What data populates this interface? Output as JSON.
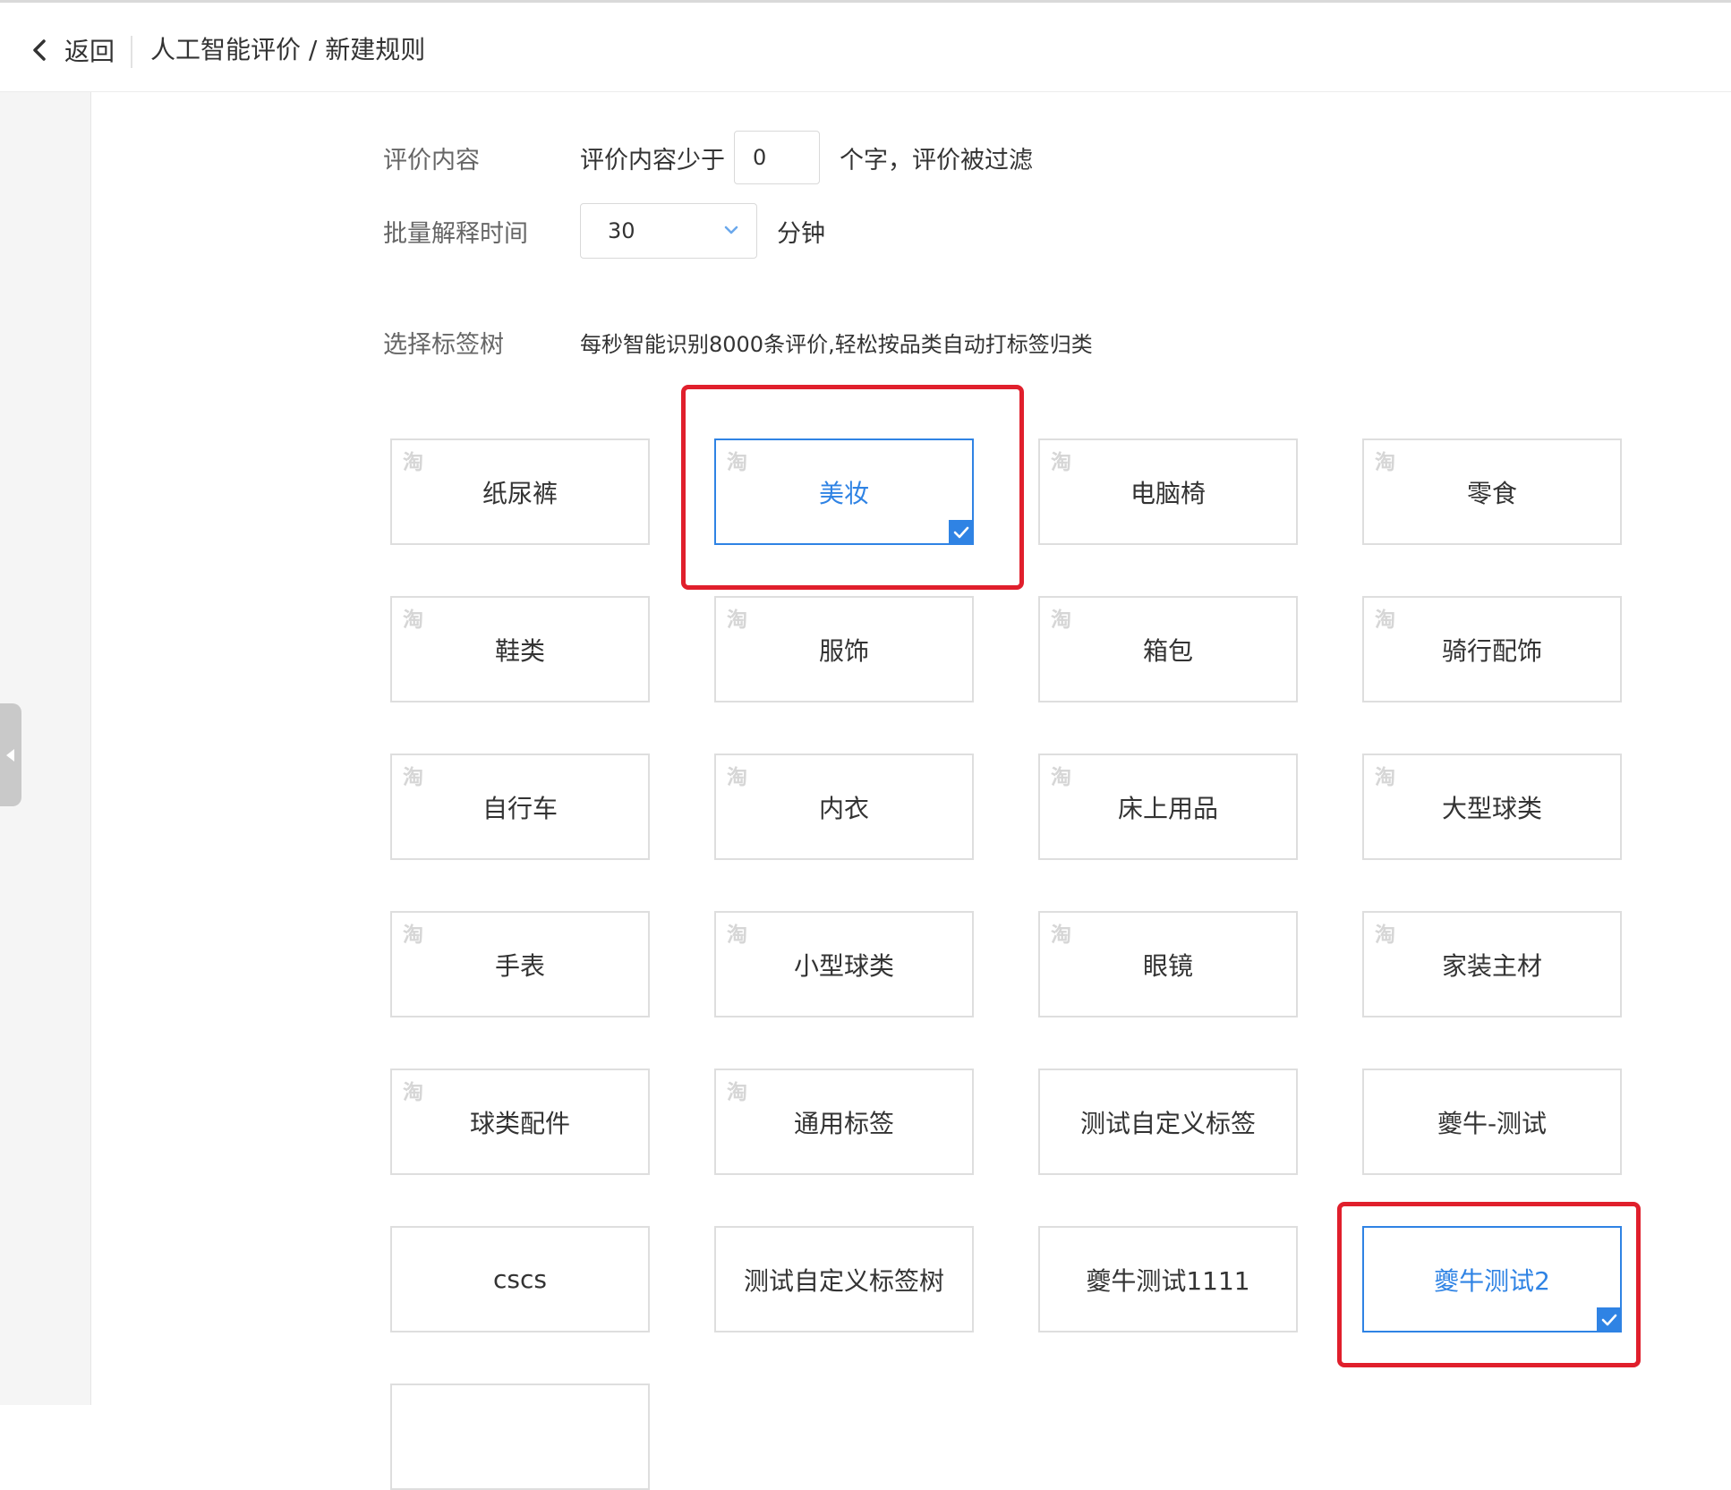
{
  "header": {
    "back_label": "返回",
    "breadcrumb": "人工智能评价 / 新建规则"
  },
  "form": {
    "content_label": "评价内容",
    "content_prefix": "评价内容少于",
    "content_value": "0",
    "content_suffix": "个字，评价被过滤",
    "batch_label": "批量解释时间",
    "batch_value": "30",
    "batch_unit": "分钟",
    "tree_label": "选择标签树",
    "tree_hint": "每秒智能识别8000条评价,轻松按品类自动打标签归类"
  },
  "tao_glyph": "淘",
  "tiles": [
    {
      "name": "纸尿裤",
      "tao": true,
      "selected": false
    },
    {
      "name": "美妆",
      "tao": true,
      "selected": true
    },
    {
      "name": "电脑椅",
      "tao": true,
      "selected": false
    },
    {
      "name": "零食",
      "tao": true,
      "selected": false
    },
    {
      "name": "鞋类",
      "tao": true,
      "selected": false
    },
    {
      "name": "服饰",
      "tao": true,
      "selected": false
    },
    {
      "name": "箱包",
      "tao": true,
      "selected": false
    },
    {
      "name": "骑行配饰",
      "tao": true,
      "selected": false
    },
    {
      "name": "自行车",
      "tao": true,
      "selected": false
    },
    {
      "name": "内衣",
      "tao": true,
      "selected": false
    },
    {
      "name": "床上用品",
      "tao": true,
      "selected": false
    },
    {
      "name": "大型球类",
      "tao": true,
      "selected": false
    },
    {
      "name": "手表",
      "tao": true,
      "selected": false
    },
    {
      "name": "小型球类",
      "tao": true,
      "selected": false
    },
    {
      "name": "眼镜",
      "tao": true,
      "selected": false
    },
    {
      "name": "家装主材",
      "tao": true,
      "selected": false
    },
    {
      "name": "球类配件",
      "tao": true,
      "selected": false
    },
    {
      "name": "通用标签",
      "tao": true,
      "selected": false
    },
    {
      "name": "测试自定义标签",
      "tao": false,
      "selected": false
    },
    {
      "name": "夔牛-测试",
      "tao": false,
      "selected": false
    },
    {
      "name": "cscs",
      "tao": false,
      "selected": false
    },
    {
      "name": "测试自定义标签树",
      "tao": false,
      "selected": false
    },
    {
      "name": "夔牛测试1111",
      "tao": false,
      "selected": false
    },
    {
      "name": "夔牛测试2",
      "tao": false,
      "selected": true
    },
    {
      "name": "",
      "tao": false,
      "selected": false
    }
  ],
  "colors": {
    "accent": "#2f83e4",
    "annotation": "#e01f2c",
    "border": "#dedede",
    "label": "#666666"
  },
  "icons": {
    "back": "chevron-left-icon",
    "dropdown": "chevron-down-icon",
    "check": "checkmark-icon",
    "collapse": "caret-left-icon",
    "tile_badge": "taobao-icon"
  }
}
